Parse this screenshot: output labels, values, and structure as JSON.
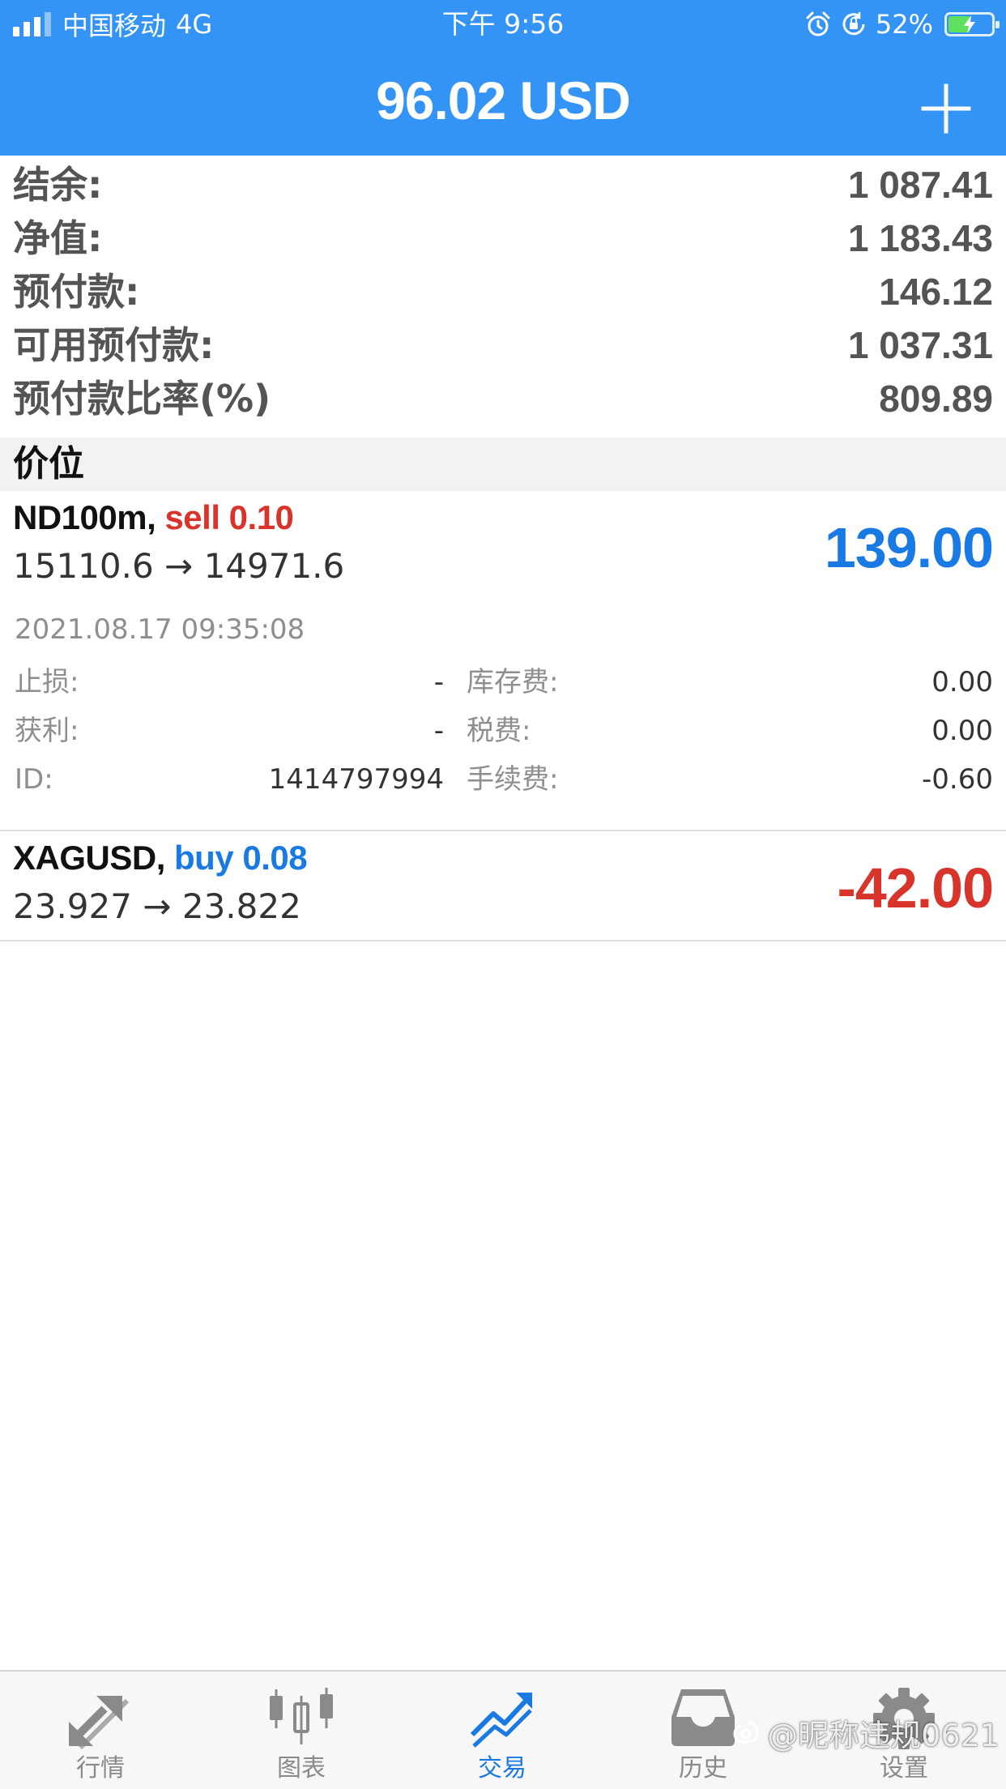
{
  "status_bar": {
    "carrier": "中国移动",
    "network": "4G",
    "time": "下午 9:56",
    "battery_percent": "52%",
    "battery_level": 0.52,
    "signal_bars": 3
  },
  "header": {
    "title": "96.02 USD",
    "background_color": "#3394f5"
  },
  "summary": [
    {
      "label": "结余:",
      "value": "1 087.41"
    },
    {
      "label": "净值:",
      "value": "1 183.43"
    },
    {
      "label": "预付款:",
      "value": "146.12"
    },
    {
      "label": "可用预付款:",
      "value": "1 037.31"
    },
    {
      "label": "预付款比率(%)",
      "value": "809.89"
    }
  ],
  "section": {
    "title": "价位"
  },
  "positions": [
    {
      "symbol": "ND100m,",
      "side_volume": "sell 0.10",
      "prices": "15110.6 → 14971.6",
      "profit": "139.00",
      "profit_color": "#1a7ae3",
      "time": "2021.08.17 09:35:08",
      "details": [
        {
          "l1": "止损:",
          "v1": "-",
          "l2": "库存费:",
          "v2": "0.00"
        },
        {
          "l1": "获利:",
          "v1": "-",
          "l2": "税费:",
          "v2": "0.00"
        },
        {
          "l1": "ID:",
          "v1": "1414797994",
          "l2": "手续费:",
          "v2": "-0.60"
        }
      ]
    },
    {
      "symbol": "XAGUSD,",
      "side_volume": "buy 0.08",
      "prices": "23.927 → 23.822",
      "profit": "-42.00",
      "profit_color": "#d9342b"
    }
  ],
  "tabs": [
    {
      "label": "行情",
      "icon": "quotes-arrows-icon",
      "active": false
    },
    {
      "label": "图表",
      "icon": "candlestick-chart-icon",
      "active": false
    },
    {
      "label": "交易",
      "icon": "trade-trend-icon",
      "active": true
    },
    {
      "label": "历史",
      "icon": "history-inbox-icon",
      "active": false
    },
    {
      "label": "设置",
      "icon": "settings-gear-icon",
      "active": false
    }
  ],
  "watermark": "@昵称违规0621"
}
